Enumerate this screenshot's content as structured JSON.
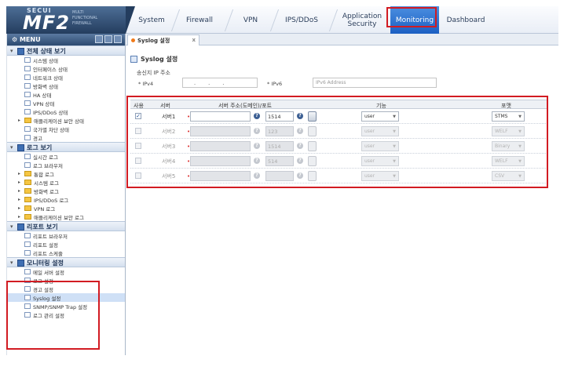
{
  "brand": {
    "top": "SECUI",
    "name": "MF2",
    "subtitle": "MULTI FUNCTIONAL FIREWALL",
    "colors": {
      "logo_bg": "#243d5e",
      "accent": "#1c5fc3",
      "highlight": "#d21b22"
    }
  },
  "top_tabs": [
    {
      "label": "System",
      "active": false
    },
    {
      "label": "Firewall",
      "active": false
    },
    {
      "label": "VPN",
      "active": false
    },
    {
      "label": "IPS/DDoS",
      "active": false
    },
    {
      "label": "Application Security",
      "active": false
    },
    {
      "label": "Monitoring",
      "active": true
    },
    {
      "label": "Dashboard",
      "active": false
    }
  ],
  "menu": {
    "title": "MENU",
    "sections": [
      {
        "title": "전체 상태 보기",
        "items": [
          {
            "label": "시스템 상태",
            "type": "doc"
          },
          {
            "label": "인터페이스 상태",
            "type": "doc"
          },
          {
            "label": "네트워크 상태",
            "type": "doc"
          },
          {
            "label": "방화벽 상태",
            "type": "doc"
          },
          {
            "label": "HA 상태",
            "type": "doc"
          },
          {
            "label": "VPN 상태",
            "type": "doc"
          },
          {
            "label": "IPS/DDoS 상태",
            "type": "doc"
          },
          {
            "label": "애플리케이션 보안 상태",
            "type": "folder"
          },
          {
            "label": "국가별 차단 상태",
            "type": "doc"
          },
          {
            "label": "경고",
            "type": "doc"
          }
        ]
      },
      {
        "title": "로그 보기",
        "items": [
          {
            "label": "실시간 로그",
            "type": "doc"
          },
          {
            "label": "로그 브라우저",
            "type": "doc"
          },
          {
            "label": "통합 로그",
            "type": "folder"
          },
          {
            "label": "시스템 로그",
            "type": "folder"
          },
          {
            "label": "방화벽 로그",
            "type": "folder"
          },
          {
            "label": "IPS/DDoS 로그",
            "type": "folder"
          },
          {
            "label": "VPN 로그",
            "type": "folder"
          },
          {
            "label": "애플리케이션 보안 로그",
            "type": "folder"
          }
        ]
      },
      {
        "title": "리포트 보기",
        "items": [
          {
            "label": "리포트 브라우저",
            "type": "doc"
          },
          {
            "label": "리포트 설정",
            "type": "doc"
          },
          {
            "label": "리포트 스케줄",
            "type": "doc"
          }
        ]
      },
      {
        "title": "모니터링 설정",
        "items": [
          {
            "label": "메일 서버 설정",
            "type": "doc"
          },
          {
            "label": "로그 설정",
            "type": "doc"
          },
          {
            "label": "경고 설정",
            "type": "doc"
          },
          {
            "label": "Syslog 설정",
            "type": "doc",
            "selected": true
          },
          {
            "label": "SNMP/SNMP Trap 설정",
            "type": "doc"
          },
          {
            "label": "로그 관리 설정",
            "type": "doc"
          }
        ]
      }
    ]
  },
  "content_tab": {
    "label": "Syslog 설정",
    "close": "x"
  },
  "page": {
    "title": "Syslog 설정",
    "source_label": "송신지 IP 주소",
    "ipv4_label": "* IPv4",
    "ipv4_value": ". . .",
    "ipv6_label": "* IPv6",
    "ipv6_placeholder": "IPv6 Address"
  },
  "server_table": {
    "headers": {
      "use": "사용",
      "server": "서버",
      "address": "서버 주소(도메인)/포트",
      "facility": "기능",
      "format": "포맷"
    },
    "rows": [
      {
        "name": "서버1",
        "enabled": true,
        "checked": true,
        "port": "1514",
        "facility": "user",
        "format": "STMS"
      },
      {
        "name": "서버2",
        "enabled": false,
        "checked": false,
        "port": "123",
        "facility": "user",
        "format": "WELF"
      },
      {
        "name": "서버3",
        "enabled": false,
        "checked": false,
        "port": "1514",
        "facility": "user",
        "format": "Binary"
      },
      {
        "name": "서버4",
        "enabled": false,
        "checked": false,
        "port": "514",
        "facility": "user",
        "format": "WELF"
      },
      {
        "name": "서버5",
        "enabled": false,
        "checked": false,
        "port": "",
        "facility": "user",
        "format": "CSV"
      }
    ]
  }
}
